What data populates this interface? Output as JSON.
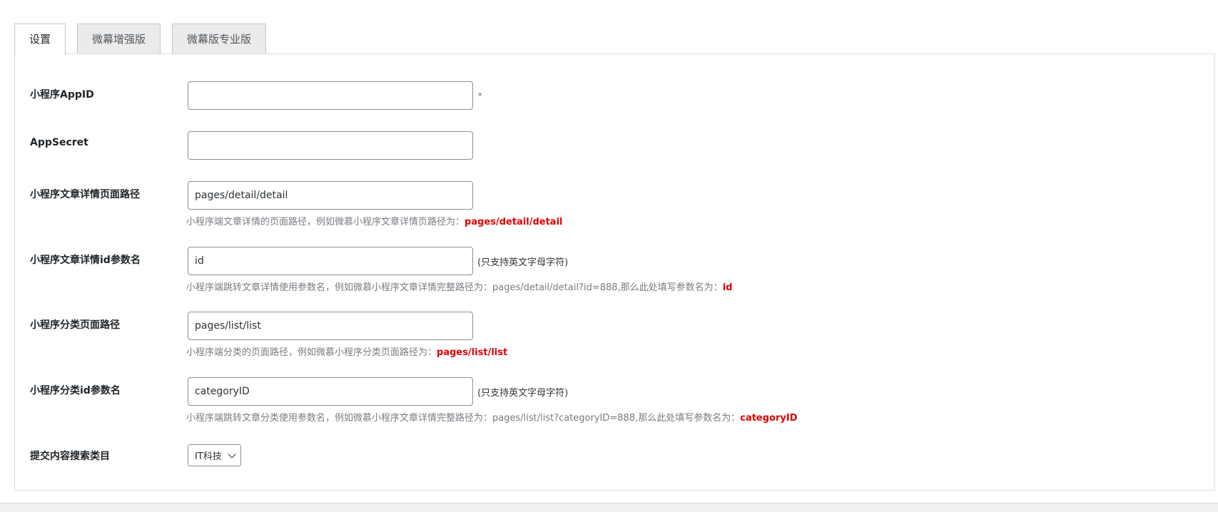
{
  "tabs": [
    {
      "label": "设置",
      "active": true
    },
    {
      "label": "微幕增强版",
      "active": false
    },
    {
      "label": "微幕版专业版",
      "active": false
    }
  ],
  "form": {
    "appid": {
      "label": "小程序AppID",
      "value": "",
      "suffix": "*"
    },
    "appsecret": {
      "label": "AppSecret",
      "value": ""
    },
    "detail_path": {
      "label": "小程序文章详情页面路径",
      "value": "pages/detail/detail",
      "desc": "小程序端文章详情的页面路径，例如微慕小程序文章详情页路径为：",
      "desc_highlight": "pages/detail/detail"
    },
    "detail_id": {
      "label": "小程序文章详情id参数名",
      "value": "id",
      "suffix": "(只支持英文字母字符)",
      "desc": "小程序端跳转文章详情使用参数名，例如微慕小程序文章详情完整路径为：pages/detail/detail?id=888,那么此处填写参数名为：",
      "desc_highlight": "id"
    },
    "list_path": {
      "label": "小程序分类页面路径",
      "value": "pages/list/list",
      "desc": "小程序端分类的页面路径，例如微慕小程序分类页面路径为：",
      "desc_highlight": "pages/list/list"
    },
    "category_id": {
      "label": "小程序分类id参数名",
      "value": "categoryID",
      "suffix": "(只支持英文字母字符)",
      "desc": "小程序端跳转文章分类使用参数名，例如微慕小程序文章详情完整路径为：pages/list/list?categoryID=888,那么此处填写参数名为：",
      "desc_highlight": "categoryID"
    },
    "search_category": {
      "label": "提交内容搜索类目",
      "selected": "IT科技"
    }
  },
  "colors": {
    "highlight": "#e00000",
    "description": "#787c82"
  }
}
